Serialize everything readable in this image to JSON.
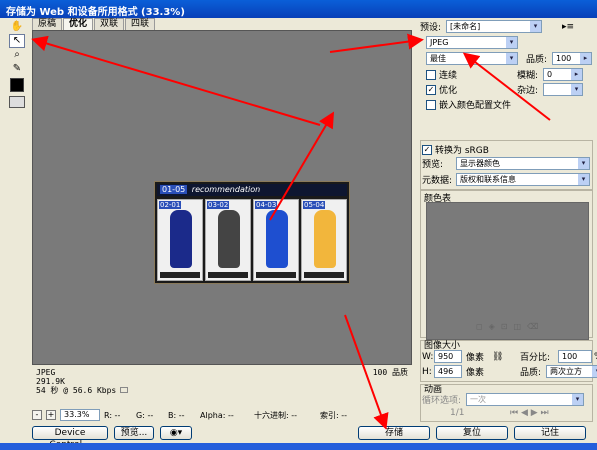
{
  "window": {
    "title": "存储为 Web 和设备所用格式 (33.3%)"
  },
  "tabs": [
    "原稿",
    "优化",
    "双联",
    "四联"
  ],
  "tools": [
    "hand-icon",
    "slice-select-icon",
    "zoom-icon",
    "eyedropper-icon"
  ],
  "colors": {
    "title_bar": "#0a5fd8",
    "canvas_bg": "#7a7a7a",
    "arrow": "#ff0000",
    "accent": "#2a4fb8"
  },
  "preview_image": {
    "heading_num": "01-05",
    "heading_text": "recommendation",
    "cards": [
      {
        "num": "02-01",
        "color": "#1b2a8a"
      },
      {
        "num": "03-02",
        "color": "#444444"
      },
      {
        "num": "04-03",
        "color": "#1e4fd0"
      },
      {
        "num": "05-04",
        "color": "#f2b63c"
      }
    ]
  },
  "info": {
    "format": "JPEG",
    "size": "291.9K",
    "time": "54 秒 @ 56.6 Kbps",
    "quality_value": "100",
    "quality_label": "品质"
  },
  "statusbar": {
    "minus": "-",
    "plus": "+",
    "zoom": "33.3%",
    "r": "R: --",
    "g": "G: --",
    "b": "B: --",
    "alpha": "Alpha: --",
    "hex": "十六进制: --",
    "index": "索引: --"
  },
  "buttons": {
    "device_central": "Device Central...",
    "preview": "预览...",
    "save": "存储",
    "reset": "复位",
    "remember": "记住"
  },
  "settings": {
    "preset_label": "预设:",
    "preset_value": "[未命名]",
    "format_value": "JPEG",
    "quality_preset": "最佳",
    "quality_label": "品质:",
    "quality_value": "100",
    "progressive_label": "连续",
    "blur_label": "模糊:",
    "blur_value": "0",
    "optimized_label": "优化",
    "matte_label": "杂边:",
    "embed_profile_label": "嵌入颜色配置文件",
    "convert_srgb_label": "转换为 sRGB",
    "preview_label": "预览:",
    "preview_value": "显示器颜色",
    "metadata_label": "元数据:",
    "metadata_value": "版权和联系信息",
    "color_table_label": "颜色表"
  },
  "image_size": {
    "label": "图像大小",
    "w_label": "W:",
    "w_value": "950",
    "h_label": "H:",
    "h_value": "496",
    "unit": "像素",
    "percent_label": "百分比:",
    "percent_value": "100",
    "percent_unit": "%",
    "quality_label": "品质:",
    "quality_value": "两次立方"
  },
  "animation": {
    "label": "动画",
    "loop_label": "循环选项:",
    "loop_value": "一次",
    "frame": "1/1"
  }
}
